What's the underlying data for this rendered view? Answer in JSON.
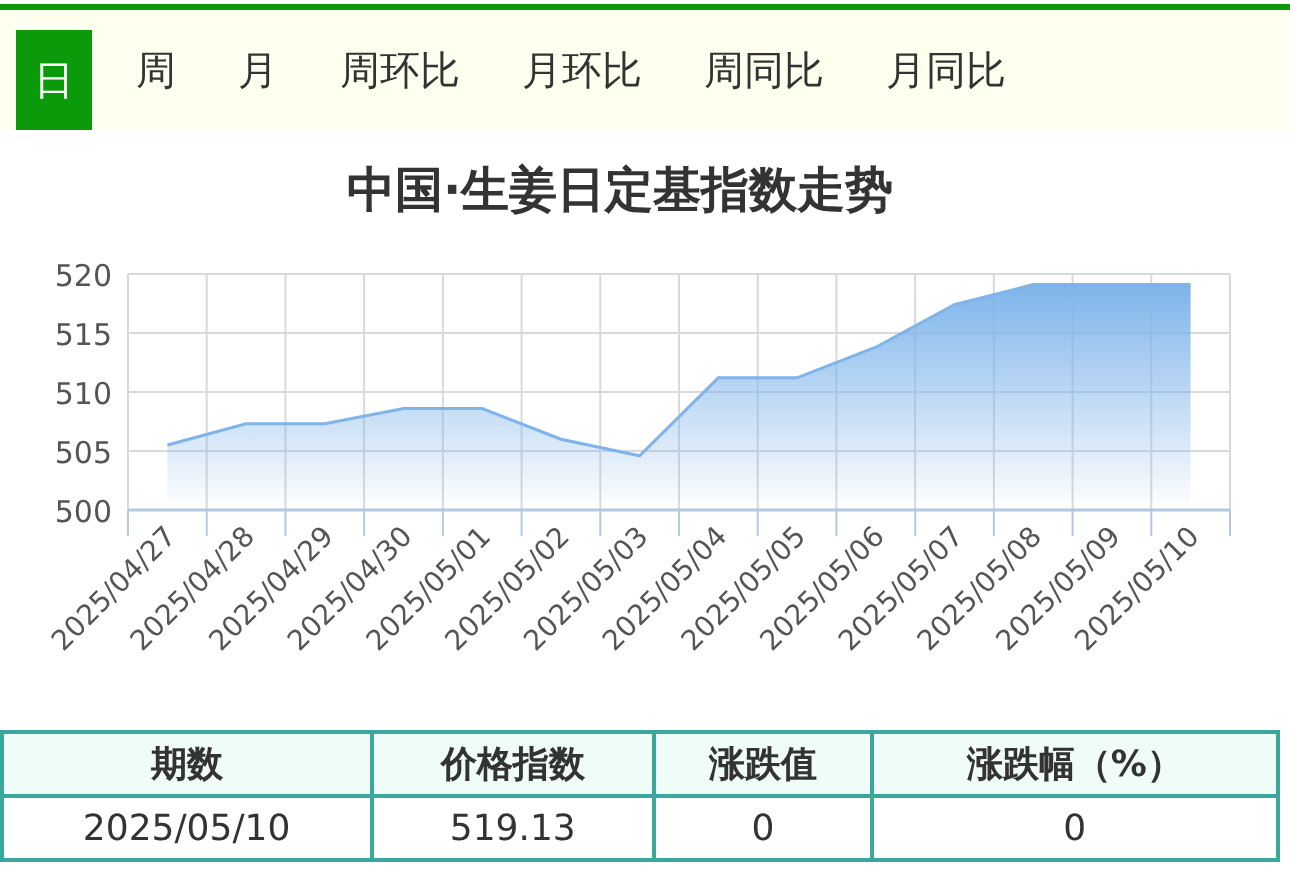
{
  "tabs": [
    {
      "label": "日",
      "selected": true
    },
    {
      "label": "周",
      "selected": false
    },
    {
      "label": "月",
      "selected": false
    },
    {
      "label": "周环比",
      "selected": false
    },
    {
      "label": "月环比",
      "selected": false
    },
    {
      "label": "周同比",
      "selected": false
    },
    {
      "label": "月同比",
      "selected": false
    }
  ],
  "chart": {
    "chart_data": {
      "type": "area",
      "title": "中国·生姜日定基指数走势",
      "categories": [
        "2025/04/27",
        "2025/04/28",
        "2025/04/29",
        "2025/04/30",
        "2025/05/01",
        "2025/05/02",
        "2025/05/03",
        "2025/05/04",
        "2025/05/05",
        "2025/05/06",
        "2025/05/07",
        "2025/05/08",
        "2025/05/09",
        "2025/05/10"
      ],
      "series": [
        {
          "color": "#7eb4ea",
          "values": [
            505.5,
            507.3,
            507.3,
            508.6,
            508.6,
            506,
            504.6,
            511.2,
            511.2,
            513.8,
            517.4,
            519.1,
            519.1,
            519.1
          ]
        }
      ],
      "ylim": [
        500,
        520
      ],
      "yticks": [
        500,
        505,
        510,
        515,
        520
      ],
      "grid": true
    }
  },
  "table": {
    "columns": [
      "期数",
      "价格指数",
      "涨跌值",
      "涨跌幅（%）"
    ],
    "rows": [
      [
        "2025/05/10",
        "519.13",
        "0",
        "0"
      ]
    ]
  }
}
